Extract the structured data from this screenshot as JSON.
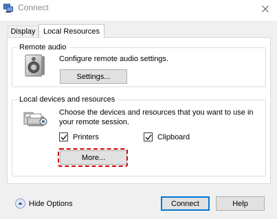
{
  "window": {
    "title": "Connect"
  },
  "tabs": [
    {
      "label": "Display"
    },
    {
      "label": "Local Resources"
    }
  ],
  "remote_audio": {
    "title": "Remote audio",
    "description": "Configure remote audio settings.",
    "settings_label": "Settings..."
  },
  "local_devices": {
    "title": "Local devices and resources",
    "description_line1": "Choose the devices and resources that you want to use in",
    "description_line2": "your remote session.",
    "printers_label": "Printers",
    "printers_checked": true,
    "clipboard_label": "Clipboard",
    "clipboard_checked": true,
    "more_label": "More..."
  },
  "footer": {
    "hide_options_label": "Hide Options",
    "connect_label": "Connect",
    "help_label": "Help"
  },
  "icons": {
    "app": "remote-desktop-icon",
    "close": "close-icon",
    "audio": "speaker-icon",
    "devices": "devices-icon",
    "hide": "collapse-up-icon"
  }
}
